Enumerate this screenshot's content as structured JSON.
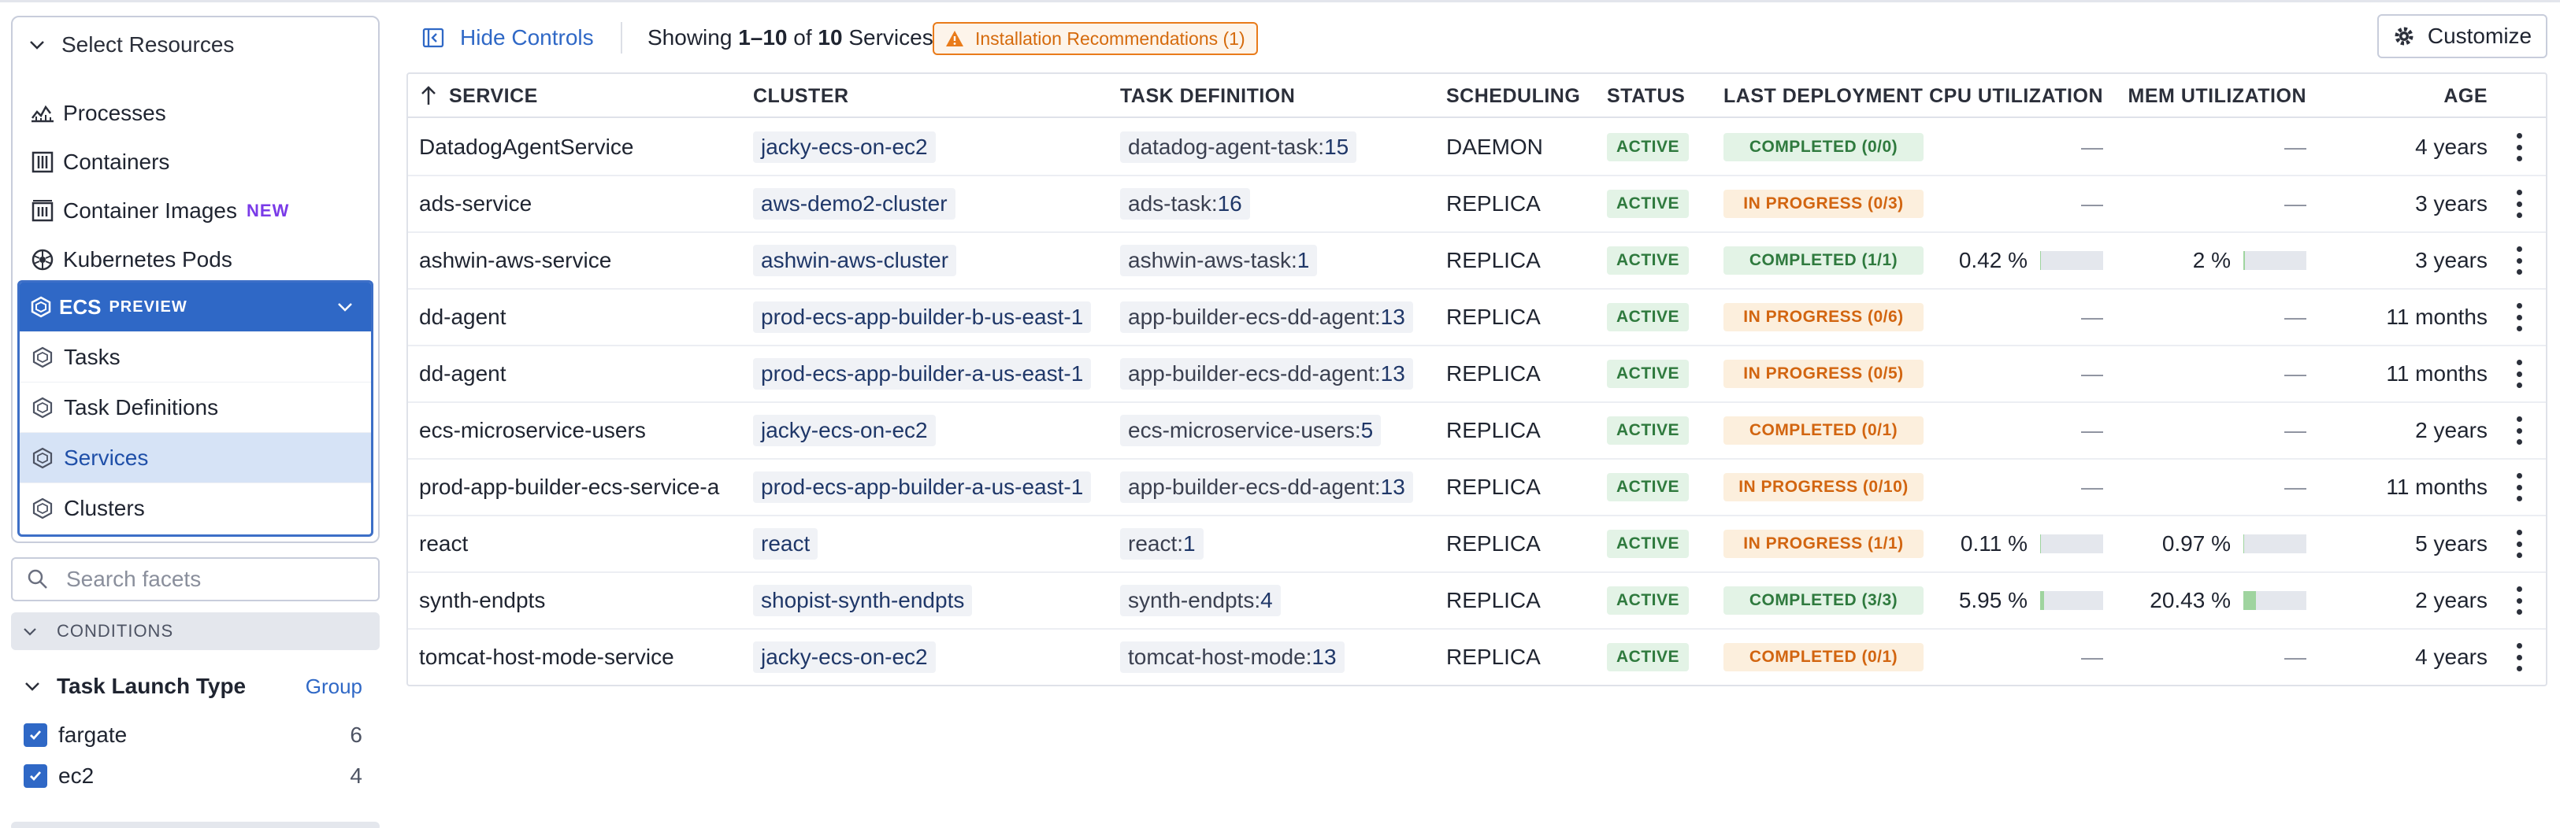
{
  "sidebar": {
    "header": "Select Resources",
    "items": [
      {
        "label": "Processes",
        "icon": "processes-icon"
      },
      {
        "label": "Containers",
        "icon": "containers-icon"
      },
      {
        "label": "Container Images",
        "icon": "container-images-icon",
        "badge": "NEW"
      },
      {
        "label": "Kubernetes Pods",
        "icon": "kubernetes-icon"
      }
    ],
    "ecs": {
      "label": "ECS",
      "preview": "PREVIEW",
      "items": [
        {
          "label": "Tasks",
          "selected": false
        },
        {
          "label": "Task Definitions",
          "selected": false
        },
        {
          "label": "Services",
          "selected": true
        },
        {
          "label": "Clusters",
          "selected": false
        }
      ]
    },
    "search_placeholder": "Search facets",
    "conditions_label": "CONDITIONS",
    "facet": {
      "title": "Task Launch Type",
      "group_label": "Group",
      "options": [
        {
          "label": "fargate",
          "count": "6",
          "checked": true
        },
        {
          "label": "ec2",
          "count": "4",
          "checked": true
        }
      ]
    }
  },
  "toolbar": {
    "hide_controls": "Hide Controls",
    "showing_prefix": "Showing ",
    "showing_range": "1–10",
    "showing_of": " of ",
    "showing_total": "10",
    "showing_suffix": " Services",
    "install_recommendations": "Installation Recommendations (1)",
    "customize": "Customize"
  },
  "table": {
    "columns": {
      "service": "SERVICE",
      "cluster": "CLUSTER",
      "task_definition": "TASK DEFINITION",
      "scheduling": "SCHEDULING",
      "status": "STATUS",
      "last_deployment": "LAST DEPLOYMENT",
      "cpu": "CPU UTILIZATION",
      "mem": "MEM UTILIZATION",
      "age": "AGE"
    },
    "rows": [
      {
        "service": "DatadogAgentService",
        "cluster": "jacky-ecs-on-ec2",
        "td_name": "datadog-agent-task:",
        "td_rev": "15",
        "scheduling": "DAEMON",
        "status": "ACTIVE",
        "deployment": "COMPLETED (0/0)",
        "deployment_kind": "completed",
        "cpu": "—",
        "cpu_fill": null,
        "mem": "—",
        "mem_fill": null,
        "age": "4 years"
      },
      {
        "service": "ads-service",
        "cluster": "aws-demo2-cluster",
        "td_name": "ads-task:",
        "td_rev": "16",
        "scheduling": "REPLICA",
        "status": "ACTIVE",
        "deployment": "IN PROGRESS (0/3)",
        "deployment_kind": "inprogress",
        "cpu": "—",
        "cpu_fill": null,
        "mem": "—",
        "mem_fill": null,
        "age": "3 years"
      },
      {
        "service": "ashwin-aws-service",
        "cluster": "ashwin-aws-cluster",
        "td_name": "ashwin-aws-task:",
        "td_rev": "1",
        "scheduling": "REPLICA",
        "status": "ACTIVE",
        "deployment": "COMPLETED (1/1)",
        "deployment_kind": "completed",
        "cpu": "0.42 %",
        "cpu_fill": 0.0042,
        "mem": "2 %",
        "mem_fill": 0.02,
        "age": "3 years"
      },
      {
        "service": "dd-agent",
        "cluster": "prod-ecs-app-builder-b-us-east-1",
        "td_name": "app-builder-ecs-dd-agent:",
        "td_rev": "13",
        "scheduling": "REPLICA",
        "status": "ACTIVE",
        "deployment": "IN PROGRESS (0/6)",
        "deployment_kind": "inprogress",
        "cpu": "—",
        "cpu_fill": null,
        "mem": "—",
        "mem_fill": null,
        "age": "11 months"
      },
      {
        "service": "dd-agent",
        "cluster": "prod-ecs-app-builder-a-us-east-1",
        "td_name": "app-builder-ecs-dd-agent:",
        "td_rev": "13",
        "scheduling": "REPLICA",
        "status": "ACTIVE",
        "deployment": "IN PROGRESS (0/5)",
        "deployment_kind": "inprogress",
        "cpu": "—",
        "cpu_fill": null,
        "mem": "—",
        "mem_fill": null,
        "age": "11 months"
      },
      {
        "service": "ecs-microservice-users",
        "cluster": "jacky-ecs-on-ec2",
        "td_name": "ecs-microservice-users:",
        "td_rev": "5",
        "scheduling": "REPLICA",
        "status": "ACTIVE",
        "deployment": "COMPLETED (0/1)",
        "deployment_kind": "completed-warn",
        "cpu": "—",
        "cpu_fill": null,
        "mem": "—",
        "mem_fill": null,
        "age": "2 years"
      },
      {
        "service": "prod-app-builder-ecs-service-a",
        "cluster": "prod-ecs-app-builder-a-us-east-1",
        "td_name": "app-builder-ecs-dd-agent:",
        "td_rev": "13",
        "scheduling": "REPLICA",
        "status": "ACTIVE",
        "deployment": "IN PROGRESS (0/10)",
        "deployment_kind": "inprogress",
        "cpu": "—",
        "cpu_fill": null,
        "mem": "—",
        "mem_fill": null,
        "age": "11 months"
      },
      {
        "service": "react",
        "cluster": "react",
        "td_name": "react:",
        "td_rev": "1",
        "scheduling": "REPLICA",
        "status": "ACTIVE",
        "deployment": "IN PROGRESS (1/1)",
        "deployment_kind": "inprogress",
        "cpu": "0.11 %",
        "cpu_fill": 0.0011,
        "mem": "0.97 %",
        "mem_fill": 0.0097,
        "age": "5 years"
      },
      {
        "service": "synth-endpts",
        "cluster": "shopist-synth-endpts",
        "td_name": "synth-endpts:",
        "td_rev": "4",
        "scheduling": "REPLICA",
        "status": "ACTIVE",
        "deployment": "COMPLETED (3/3)",
        "deployment_kind": "completed",
        "cpu": "5.95 %",
        "cpu_fill": 0.0595,
        "mem": "20.43 %",
        "mem_fill": 0.2043,
        "age": "2 years"
      },
      {
        "service": "tomcat-host-mode-service",
        "cluster": "jacky-ecs-on-ec2",
        "td_name": "tomcat-host-mode:",
        "td_rev": "13",
        "scheduling": "REPLICA",
        "status": "ACTIVE",
        "deployment": "COMPLETED (0/1)",
        "deployment_kind": "completed-warn",
        "cpu": "—",
        "cpu_fill": null,
        "mem": "—",
        "mem_fill": null,
        "age": "4 years"
      }
    ]
  },
  "colors": {
    "accent": "#2f68c6",
    "status_green_bg": "#e3f3e6",
    "status_green_text": "#2f7a3e",
    "warn_bg": "#fcefdd",
    "warn_text": "#d26510",
    "bar_fill": "#9fd49f"
  }
}
